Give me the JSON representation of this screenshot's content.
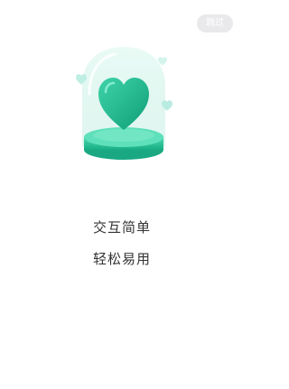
{
  "skip_button": {
    "label": "跳过"
  },
  "illustration": {
    "icon": "heart-in-glass-dome-icon",
    "colors": {
      "heart": "#16b98e",
      "platform": "#25c79b",
      "dome": "#d6f4ec",
      "floating_heart": "#b9ece0"
    }
  },
  "caption": {
    "line1": "交互简单",
    "line2": "轻松易用"
  }
}
